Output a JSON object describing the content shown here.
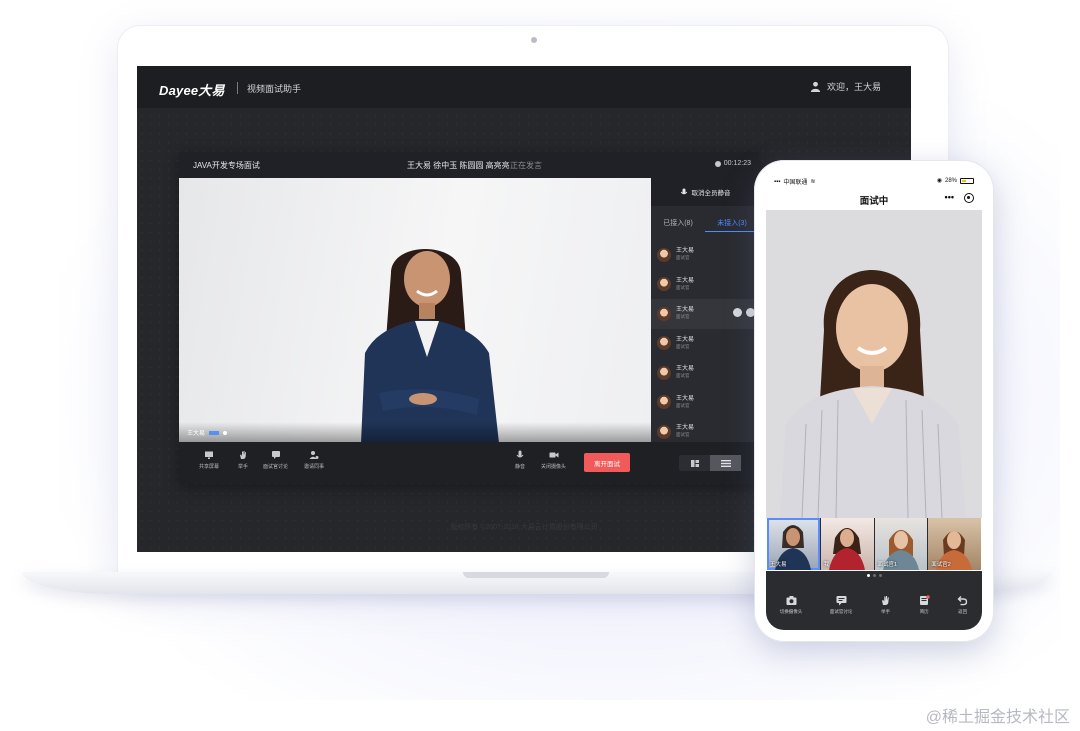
{
  "laptop": {
    "header": {
      "logo": "Dayee大易",
      "app_name": "视频面试助手",
      "welcome": "欢迎，王大易"
    },
    "meeting": {
      "title": "JAVA开发专场面试",
      "participants": "王大易 徐中玉 陈圆圆 高亮亮",
      "speaking_status": "正在发言",
      "timer": "00:12:23",
      "video_label": "王大易",
      "toolbar": {
        "share_screen": "共享屏幕",
        "raise_hand": "举手",
        "discussion": "面试官讨论",
        "invite": "邀请同事",
        "mute": "静音",
        "camera_off": "关闭摄像头",
        "leave": "离开面试"
      }
    },
    "sidebar": {
      "mute_all": "取消全员静音",
      "tabs": [
        "已接入(8)",
        "未接入(3)"
      ],
      "participants": [
        {
          "name": "王大易",
          "role": "面试官"
        },
        {
          "name": "王大易",
          "role": "面试官"
        },
        {
          "name": "王大易",
          "role": "面试官"
        },
        {
          "name": "王大易",
          "role": "面试官"
        },
        {
          "name": "王大易",
          "role": "面试官"
        },
        {
          "name": "王大易",
          "role": "面试官"
        },
        {
          "name": "王大易",
          "role": "面试官"
        }
      ]
    },
    "copyright": "版权所有 ©2007-2018 大易云计算股份有限公司"
  },
  "phone": {
    "status": {
      "carrier": "中国联通",
      "battery": "28%"
    },
    "nav": {
      "title": "面试中",
      "more": "•••"
    },
    "thumbnails": [
      {
        "name": "王大易"
      },
      {
        "name": "我"
      },
      {
        "name": "面试官1"
      },
      {
        "name": "面试官2"
      }
    ],
    "toolbar": {
      "switch_camera": "切换摄像头",
      "discussion": "面试官讨论",
      "raise_hand": "举手",
      "resume": "简历",
      "back": "返回"
    }
  },
  "colors": {
    "accent": "#4d8dff",
    "leave": "#f05a5a",
    "screen_bg": "#26272b"
  },
  "watermark": "@稀土掘金技术社区"
}
